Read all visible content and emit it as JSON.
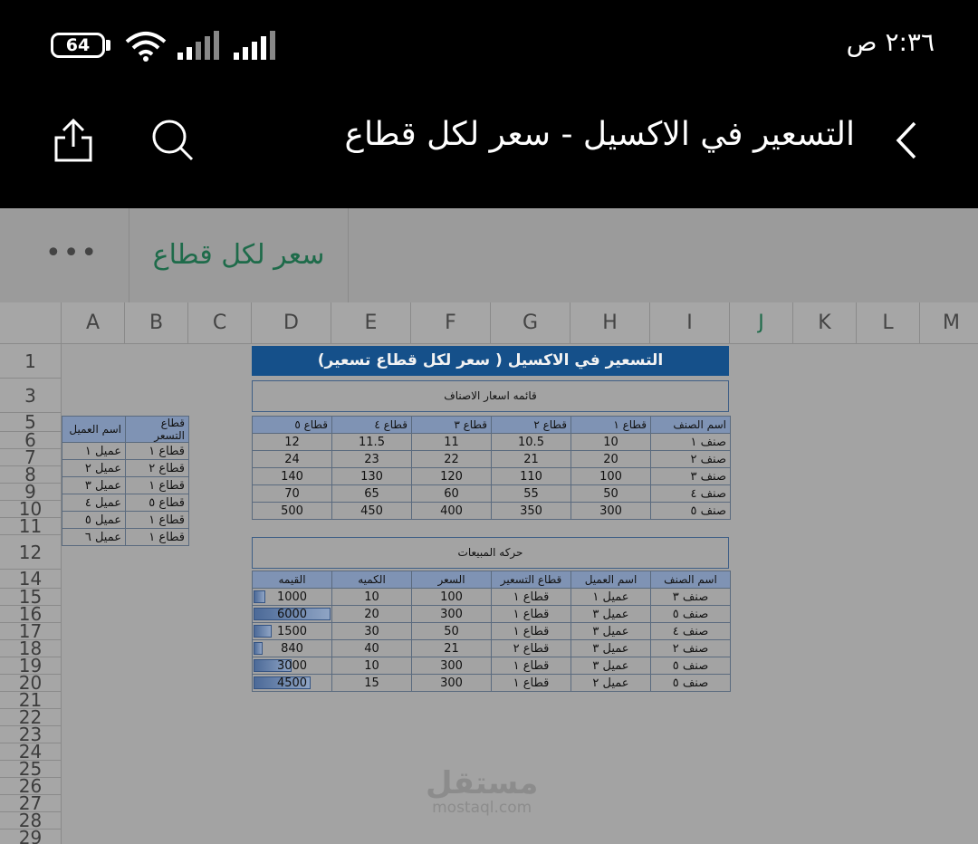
{
  "status_bar": {
    "battery": "64",
    "clock": "٢:٣٦ ص"
  },
  "title_bar": {
    "title": "التسعير في الاكسيل - سعر لكل قطاع"
  },
  "sheet_tab": {
    "label": "سعر لكل قطاع",
    "more": "•••"
  },
  "grid": {
    "columns": [
      "A",
      "B",
      "C",
      "D",
      "E",
      "F",
      "G",
      "H",
      "I",
      "J",
      "K",
      "L",
      "M"
    ],
    "rows": [
      "1",
      "3",
      "5",
      "6",
      "7",
      "8",
      "9",
      "10",
      "11",
      "12",
      "14",
      "15",
      "16",
      "17",
      "18",
      "19",
      "20",
      "21",
      "22",
      "23",
      "24",
      "25",
      "26",
      "27",
      "28",
      "29"
    ]
  },
  "banner": {
    "title": "التسعير في الاكسيل ( سعر لكل قطاع تسعير)"
  },
  "price_list": {
    "caption": "قائمه اسعار الاصناف",
    "headers": [
      "اسم الصنف",
      "قطاع ١",
      "قطاع ٢",
      "قطاع ٣",
      "قطاع ٤",
      "قطاع ٥"
    ],
    "rows": [
      [
        "صنف ١",
        "10",
        "10.5",
        "11",
        "11.5",
        "12"
      ],
      [
        "صنف ٢",
        "20",
        "21",
        "22",
        "23",
        "24"
      ],
      [
        "صنف ٣",
        "100",
        "110",
        "120",
        "130",
        "140"
      ],
      [
        "صنف ٤",
        "50",
        "55",
        "60",
        "65",
        "70"
      ],
      [
        "صنف ٥",
        "300",
        "350",
        "400",
        "450",
        "500"
      ]
    ]
  },
  "customers": {
    "headers": [
      "اسم العميل",
      "قطاع التسعر"
    ],
    "rows": [
      [
        "عميل ١",
        "قطاع ١"
      ],
      [
        "عميل ٢",
        "قطاع ٢"
      ],
      [
        "عميل ٣",
        "قطاع ١"
      ],
      [
        "عميل ٤",
        "قطاع ٥"
      ],
      [
        "عميل ٥",
        "قطاع ١"
      ],
      [
        "عميل ٦",
        "قطاع ١"
      ]
    ]
  },
  "sales": {
    "caption": "حركه المبيعات",
    "headers": [
      "اسم الصنف",
      "اسم العميل",
      "قطاع التسعير",
      "السعر",
      "الكميه",
      "القيمه"
    ],
    "rows": [
      {
        "item": "صنف ٣",
        "customer": "عميل ١",
        "sector": "قطاع ١",
        "price": "100",
        "qty": "10",
        "value": "1000",
        "fill": 0.17
      },
      {
        "item": "صنف ٥",
        "customer": "عميل ٣",
        "sector": "قطاع ١",
        "price": "300",
        "qty": "20",
        "value": "6000",
        "fill": 1.0
      },
      {
        "item": "صنف ٤",
        "customer": "عميل ٣",
        "sector": "قطاع ١",
        "price": "50",
        "qty": "30",
        "value": "1500",
        "fill": 0.25
      },
      {
        "item": "صنف ٢",
        "customer": "عميل ٣",
        "sector": "قطاع ٢",
        "price": "21",
        "qty": "40",
        "value": "840",
        "fill": 0.14
      },
      {
        "item": "صنف ٥",
        "customer": "عميل ٣",
        "sector": "قطاع ١",
        "price": "300",
        "qty": "10",
        "value": "3000",
        "fill": 0.5
      },
      {
        "item": "صنف ٥",
        "customer": "عميل ٢",
        "sector": "قطاع ١",
        "price": "300",
        "qty": "15",
        "value": "4500",
        "fill": 0.75
      }
    ]
  },
  "watermark": {
    "arabic": "مستقل",
    "latin": "mostaql.com"
  },
  "colors": {
    "accent": "#15508a",
    "header_fill": "#7f93b4",
    "tab_text": "#1e6b4a"
  }
}
